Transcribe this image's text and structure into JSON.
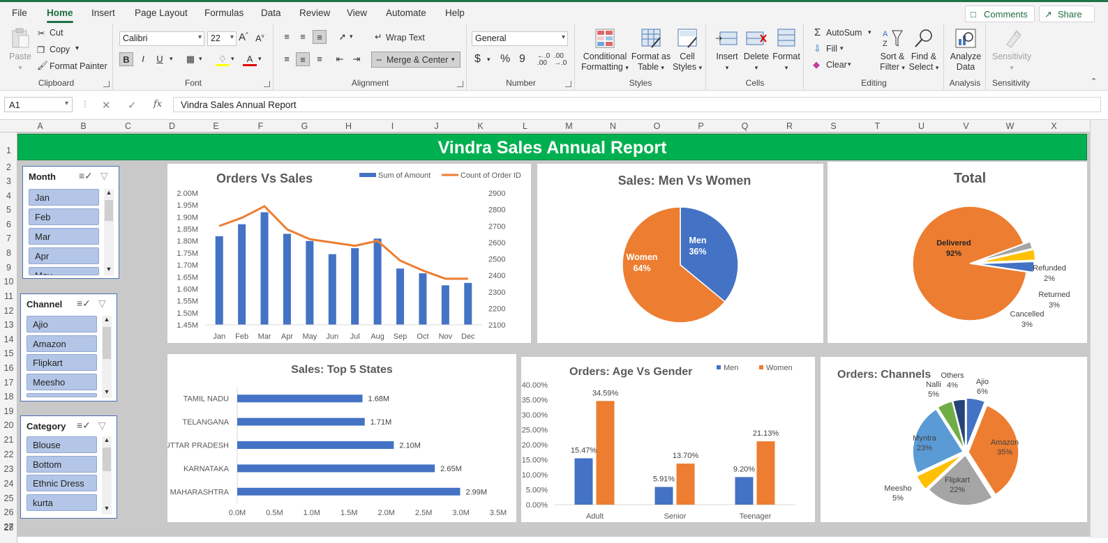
{
  "menu": {
    "items": [
      "File",
      "Home",
      "Insert",
      "Page Layout",
      "Formulas",
      "Data",
      "Review",
      "View",
      "Automate",
      "Help"
    ],
    "active": "Home",
    "comments_label": "Comments",
    "share_label": "Share"
  },
  "ribbon": {
    "clipboard": {
      "paste": "Paste",
      "cut": "Cut",
      "copy": "Copy",
      "format_painter": "Format Painter",
      "label": "Clipboard"
    },
    "font": {
      "name": "Calibri",
      "size": "22",
      "label": "Font"
    },
    "alignment": {
      "wrap_text": "Wrap Text",
      "merge_center": "Merge & Center",
      "label": "Alignment"
    },
    "number": {
      "format": "General",
      "label": "Number"
    },
    "styles": {
      "conditional": "Conditional",
      "formatting": "Formatting",
      "format_as": "Format as",
      "table": "Table",
      "cell": "Cell",
      "styles": "Styles",
      "label": "Styles"
    },
    "cells": {
      "insert": "Insert",
      "delete": "Delete",
      "format": "Format",
      "label": "Cells"
    },
    "editing": {
      "autosum": "AutoSum",
      "fill": "Fill",
      "clear": "Clear",
      "sort": "Sort &",
      "filter": "Filter",
      "find": "Find &",
      "select": "Select",
      "label": "Editing"
    },
    "analysis": {
      "analyze": "Analyze",
      "data": "Data",
      "label": "Analysis"
    },
    "sensitivity": {
      "button": "Sensitivity",
      "label": "Sensitivity"
    }
  },
  "formula_bar": {
    "name_box": "A1",
    "fx": "fx",
    "formula": "Vindra Sales Annual Report"
  },
  "columns": [
    "A",
    "B",
    "C",
    "D",
    "E",
    "F",
    "G",
    "H",
    "I",
    "J",
    "K",
    "L",
    "M",
    "N",
    "O",
    "P",
    "Q",
    "R",
    "S",
    "T",
    "U",
    "V",
    "W",
    "X"
  ],
  "rows": [
    "1",
    "2",
    "3",
    "4",
    "5",
    "6",
    "7",
    "8",
    "9",
    "10",
    "11",
    "12",
    "13",
    "14",
    "15",
    "16",
    "17",
    "18",
    "19",
    "20",
    "21",
    "22",
    "23",
    "24",
    "25",
    "26",
    "27",
    "28"
  ],
  "report_title": "Vindra Sales Annual Report",
  "slicers": [
    {
      "title": "Month",
      "items": [
        "Jan",
        "Feb",
        "Mar",
        "Apr",
        "May"
      ]
    },
    {
      "title": "Channel",
      "items": [
        "Ajio",
        "Amazon",
        "Flipkart",
        "Meesho",
        ""
      ]
    },
    {
      "title": "Category",
      "items": [
        "Blouse",
        "Bottom",
        "Ethnic Dress",
        "kurta"
      ]
    }
  ],
  "colors": {
    "blue": "#4472c4",
    "orange": "#ed7d31",
    "gray": "#a5a5a5",
    "yellow": "#ffc000",
    "lightblue": "#5b9bd5",
    "green": "#70ad47",
    "navy": "#264478",
    "title_green": "#00b050"
  },
  "chart_data": [
    {
      "id": "orders-vs-sales",
      "type": "bar",
      "title": "Orders Vs Sales",
      "categories": [
        "Jan",
        "Feb",
        "Mar",
        "Apr",
        "May",
        "Jun",
        "Jul",
        "Aug",
        "Sep",
        "Oct",
        "Nov",
        "Dec"
      ],
      "series": [
        {
          "name": "Sum of Amount",
          "axis": "left",
          "kind": "bar",
          "values": [
            1.82,
            1.87,
            1.92,
            1.83,
            1.8,
            1.745,
            1.77,
            1.81,
            1.685,
            1.665,
            1.615,
            1.625
          ]
        },
        {
          "name": "Count of Order ID",
          "axis": "right",
          "kind": "line",
          "values": [
            2700,
            2750,
            2820,
            2680,
            2620,
            2600,
            2580,
            2610,
            2490,
            2430,
            2380,
            2380
          ]
        }
      ],
      "left_ticks": [
        "2.00M",
        "1.95M",
        "1.90M",
        "1.85M",
        "1.80M",
        "1.75M",
        "1.70M",
        "1.65M",
        "1.60M",
        "1.55M",
        "1.50M",
        "1.45M"
      ],
      "right_ticks": [
        "2900",
        "2800",
        "2700",
        "2600",
        "2500",
        "2400",
        "2300",
        "2200",
        "2100"
      ],
      "ylim_left": [
        1.45,
        2.0
      ],
      "ylim_right": [
        2100,
        2900
      ],
      "legend": "top-right"
    },
    {
      "id": "sales-men-women",
      "type": "pie",
      "title": "Sales: Men Vs Women",
      "slices": [
        {
          "label": "Men",
          "pct": "36%",
          "value": 36
        },
        {
          "label": "Women",
          "pct": "64%",
          "value": 64
        }
      ]
    },
    {
      "id": "total-status",
      "type": "pie",
      "title": "Total",
      "slices": [
        {
          "label": "Delivered",
          "pct": "92%",
          "value": 92
        },
        {
          "label": "Refunded",
          "pct": "2%",
          "value": 2
        },
        {
          "label": "Returned",
          "pct": "3%",
          "value": 3
        },
        {
          "label": "Cancelled",
          "pct": "3%",
          "value": 3
        }
      ]
    },
    {
      "id": "top-states",
      "type": "bar",
      "orientation": "horizontal",
      "title": "Sales: Top 5 States",
      "categories": [
        "TAMIL NADU",
        "TELANGANA",
        "UTTAR PRADESH",
        "KARNATAKA",
        "MAHARASHTRA"
      ],
      "values": [
        1.68,
        1.71,
        2.1,
        2.65,
        2.99
      ],
      "value_labels": [
        "1.68M",
        "1.71M",
        "2.10M",
        "2.65M",
        "2.99M"
      ],
      "x_ticks": [
        "0.0M",
        "0.5M",
        "1.0M",
        "1.5M",
        "2.0M",
        "2.5M",
        "3.0M",
        "3.5M"
      ],
      "xlim": [
        0,
        3.5
      ]
    },
    {
      "id": "age-vs-gender",
      "type": "bar",
      "title": "Orders: Age Vs Gender",
      "categories": [
        "Adult",
        "Senior",
        "Teenager"
      ],
      "series": [
        {
          "name": "Men",
          "values": [
            15.47,
            5.91,
            9.2
          ],
          "labels": [
            "15.47%",
            "5.91%",
            "9.20%"
          ]
        },
        {
          "name": "Women",
          "values": [
            34.59,
            13.7,
            21.13
          ],
          "labels": [
            "34.59%",
            "13.70%",
            "21.13%"
          ]
        }
      ],
      "y_ticks": [
        "40.00%",
        "35.00%",
        "30.00%",
        "25.00%",
        "20.00%",
        "15.00%",
        "10.00%",
        "5.00%",
        "0.00%"
      ],
      "ylim": [
        0,
        40
      ],
      "legend": "top-right"
    },
    {
      "id": "orders-channels",
      "type": "pie",
      "title": "Orders: Channels",
      "slices": [
        {
          "label": "Ajio",
          "pct": "6%",
          "value": 6
        },
        {
          "label": "Amazon",
          "pct": "35%",
          "value": 35
        },
        {
          "label": "Flipkart",
          "pct": "22%",
          "value": 22
        },
        {
          "label": "Meesho",
          "pct": "5%",
          "value": 5
        },
        {
          "label": "Myntra",
          "pct": "23%",
          "value": 23
        },
        {
          "label": "Nalli",
          "pct": "5%",
          "value": 5
        },
        {
          "label": "Others",
          "pct": "4%",
          "value": 4
        }
      ]
    }
  ]
}
